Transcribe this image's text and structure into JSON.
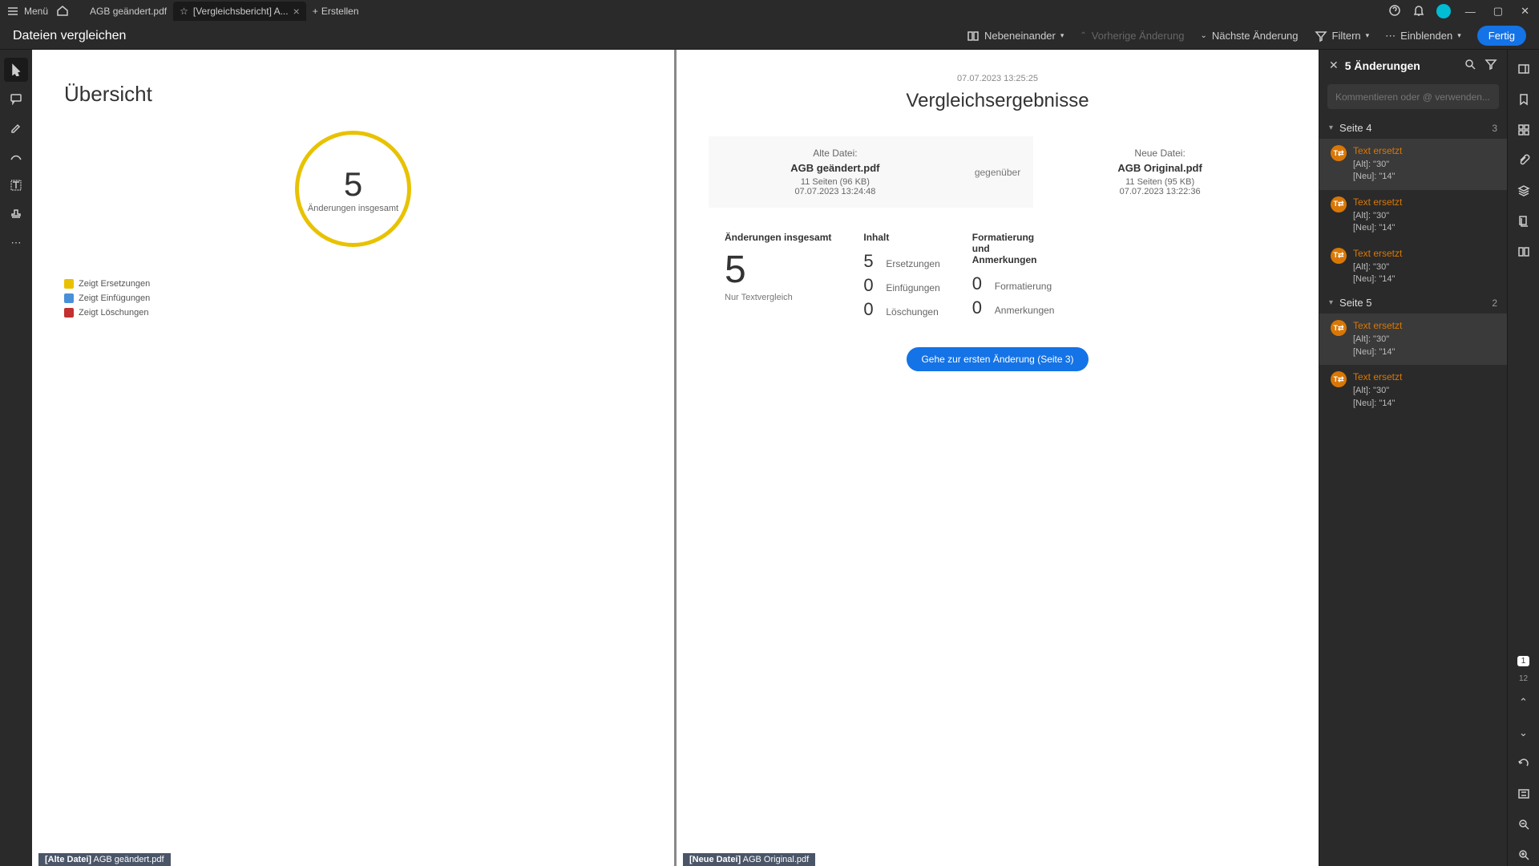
{
  "titlebar": {
    "menu": "Menü",
    "tabs": [
      {
        "label": "AGB geändert.pdf",
        "active": false
      },
      {
        "label": "[Vergleichsbericht] A...",
        "active": true
      }
    ],
    "create": "Erstellen"
  },
  "toolbar": {
    "title": "Dateien vergleichen",
    "sideBySide": "Nebeneinander",
    "prevChange": "Vorherige Änderung",
    "nextChange": "Nächste Änderung",
    "filter": "Filtern",
    "showHide": "Einblenden",
    "done": "Fertig"
  },
  "leftDoc": {
    "overview_title": "Übersicht",
    "circle_num": "5",
    "circle_label": "Änderungen insgesamt",
    "legend": {
      "replace": "Zeigt Ersetzungen",
      "insert": "Zeigt Einfügungen",
      "delete": "Zeigt Löschungen"
    },
    "footer_pre": "[Alte Datei]",
    "footer_name": "AGB geändert.pdf"
  },
  "rightDoc": {
    "timestamp": "07.07.2023 13:25:25",
    "title": "Vergleichsergebnisse",
    "oldFile": {
      "label": "Alte Datei:",
      "name": "AGB geändert.pdf",
      "meta1": "11 Seiten (96 KB)",
      "meta2": "07.07.2023 13:24:48"
    },
    "vs": "gegenüber",
    "newFile": {
      "label": "Neue Datei:",
      "name": "AGB Original.pdf",
      "meta1": "11 Seiten (95 KB)",
      "meta2": "07.07.2023 13:22:36"
    },
    "stats": {
      "total_head": "Änderungen insgesamt",
      "total_num": "5",
      "total_sub": "Nur Textvergleich",
      "content_head": "Inhalt",
      "replace_n": "5",
      "replace_l": "Ersetzungen",
      "insert_n": "0",
      "insert_l": "Einfügungen",
      "delete_n": "0",
      "delete_l": "Löschungen",
      "format_head": "Formatierung und Anmerkungen",
      "format_n": "0",
      "format_l": "Formatierung",
      "annot_n": "0",
      "annot_l": "Anmerkungen"
    },
    "cta": "Gehe zur ersten Änderung (Seite 3)",
    "footer_pre": "[Neue Datei]",
    "footer_name": "AGB Original.pdf"
  },
  "panel": {
    "title": "5 Änderungen",
    "comment_placeholder": "Kommentieren oder @ verwenden...",
    "sections": [
      {
        "label": "Seite 4",
        "count": "3"
      },
      {
        "label": "Seite 5",
        "count": "2"
      }
    ],
    "items": [
      {
        "title": "Text ersetzt",
        "l1": "[Alt]: \"30\"",
        "l2": "[Neu]: \"14\"",
        "sel": true
      },
      {
        "title": "Text ersetzt",
        "l1": "[Alt]: \"30\"",
        "l2": "[Neu]: \"14\"",
        "sel": false
      },
      {
        "title": "Text ersetzt",
        "l1": "[Alt]: \"30\"",
        "l2": "[Neu]: \"14\"",
        "sel": false
      },
      {
        "title": "Text ersetzt",
        "l1": "[Alt]: \"30\"",
        "l2": "[Neu]: \"14\"",
        "sel": true
      },
      {
        "title": "Text ersetzt",
        "l1": "[Alt]: \"30\"",
        "l2": "[Neu]: \"14\"",
        "sel": false
      }
    ]
  },
  "farRight": {
    "page": "1",
    "total": "12"
  }
}
